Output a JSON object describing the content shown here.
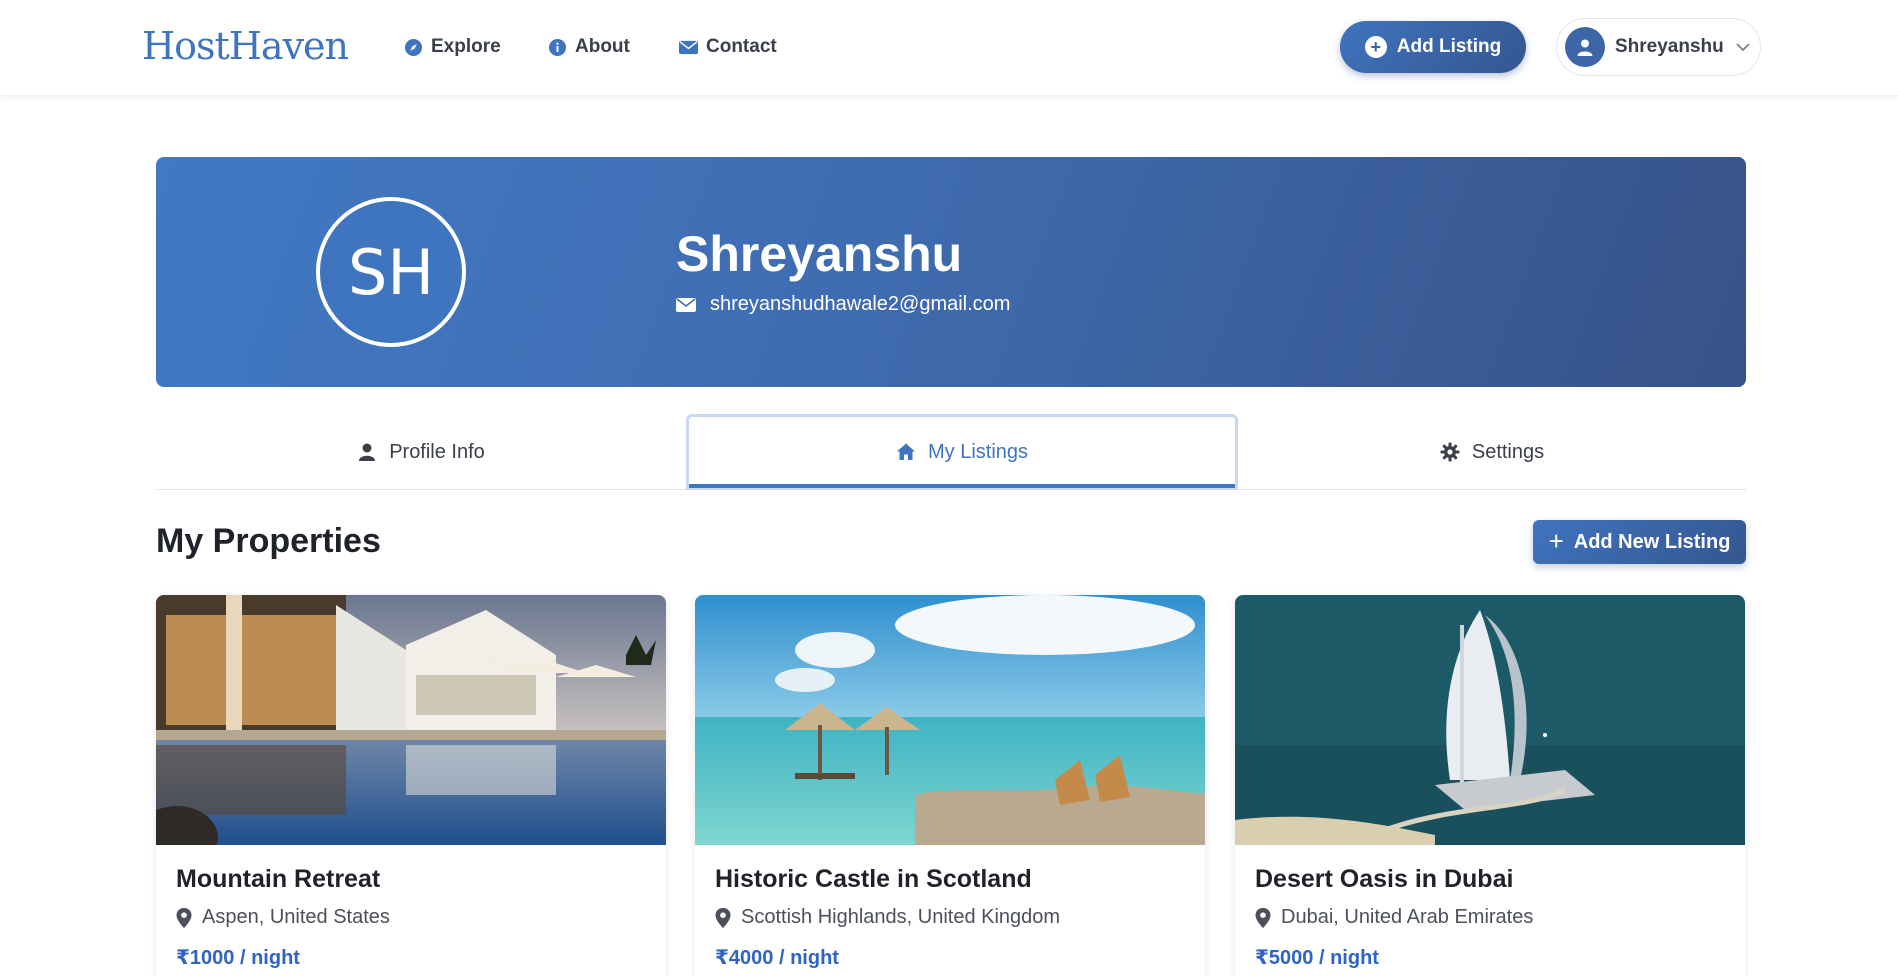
{
  "navbar": {
    "logo": "HostHaven",
    "links": [
      {
        "label": "Explore",
        "icon": "compass-icon"
      },
      {
        "label": "About",
        "icon": "info-icon"
      },
      {
        "label": "Contact",
        "icon": "envelope-icon"
      }
    ],
    "add_listing_label": "Add Listing",
    "user_name": "Shreyanshu"
  },
  "profile": {
    "initials": "SH",
    "name": "Shreyanshu",
    "email": "shreyanshudhawale2@gmail.com"
  },
  "tabs": [
    {
      "label": "Profile Info",
      "icon": "user-icon",
      "active": false
    },
    {
      "label": "My Listings",
      "icon": "home-icon",
      "active": true
    },
    {
      "label": "Settings",
      "icon": "gear-icon",
      "active": false
    }
  ],
  "section": {
    "title": "My Properties",
    "add_new_label": "Add New Listing"
  },
  "listings": [
    {
      "title": "Mountain Retreat",
      "location": "Aspen, United States",
      "price": "₹1000 / night",
      "image": "resort-pool-image"
    },
    {
      "title": "Historic Castle in Scotland",
      "location": "Scottish Highlands, United Kingdom",
      "price": "₹4000 / night",
      "image": "beach-umbrellas-image"
    },
    {
      "title": "Desert Oasis in Dubai",
      "location": "Dubai, United Arab Emirates",
      "price": "₹5000 / night",
      "image": "burj-al-arab-image"
    }
  ],
  "colors": {
    "brand": "#3f74bf",
    "brand_dark": "#35568f",
    "price": "#2f63c5"
  }
}
